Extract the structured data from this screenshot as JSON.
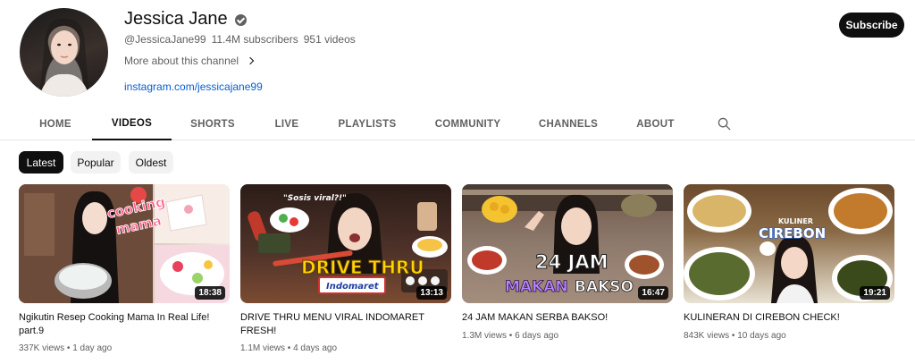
{
  "channel": {
    "name": "Jessica Jane",
    "handle": "@JessicaJane99",
    "subscribers": "11.4M subscribers",
    "videos_count": "951 videos",
    "more_about": "More about this channel",
    "link": "instagram.com/jessicajane99",
    "subscribe_label": "Subscribe"
  },
  "tabs": [
    {
      "label": "HOME"
    },
    {
      "label": "VIDEOS"
    },
    {
      "label": "SHORTS"
    },
    {
      "label": "LIVE"
    },
    {
      "label": "PLAYLISTS"
    },
    {
      "label": "COMMUNITY"
    },
    {
      "label": "CHANNELS"
    },
    {
      "label": "ABOUT"
    }
  ],
  "active_tab": "VIDEOS",
  "chips": [
    {
      "label": "Latest"
    },
    {
      "label": "Popular"
    },
    {
      "label": "Oldest"
    }
  ],
  "videos": [
    {
      "title": "Ngikutin Resep Cooking Mama In Real Life! part.9",
      "views": "337K views",
      "age": "1 day ago",
      "duration": "18:38",
      "thumb_text_a": "cooking",
      "thumb_text_b": "mama"
    },
    {
      "title": "DRIVE THRU MENU VIRAL INDOMARET FRESH!",
      "views": "1.1M views",
      "age": "4 days ago",
      "duration": "13:13",
      "thumb_text_a": "\"Sosis viral?!\"",
      "thumb_text_b": "DRIVE THRU",
      "thumb_text_c": "Indomaret"
    },
    {
      "title": "24 JAM MAKAN SERBA BAKSO!",
      "views": "1.3M views",
      "age": "6 days ago",
      "duration": "16:47",
      "thumb_text_a": "24 JAM",
      "thumb_text_b": "MAKAN",
      "thumb_text_c": "BAKSO"
    },
    {
      "title": "KULINERAN DI CIREBON CHECK!",
      "views": "843K views",
      "age": "10 days ago",
      "duration": "19:21",
      "thumb_text_a": "KULINER",
      "thumb_text_b": "CIREBON"
    }
  ],
  "meta_separator": "•",
  "colors": {
    "accent_dark": "#0f0f0f",
    "link_blue": "#065fd4",
    "secondary_text": "#606060",
    "chip_bg": "#f2f2f2"
  }
}
